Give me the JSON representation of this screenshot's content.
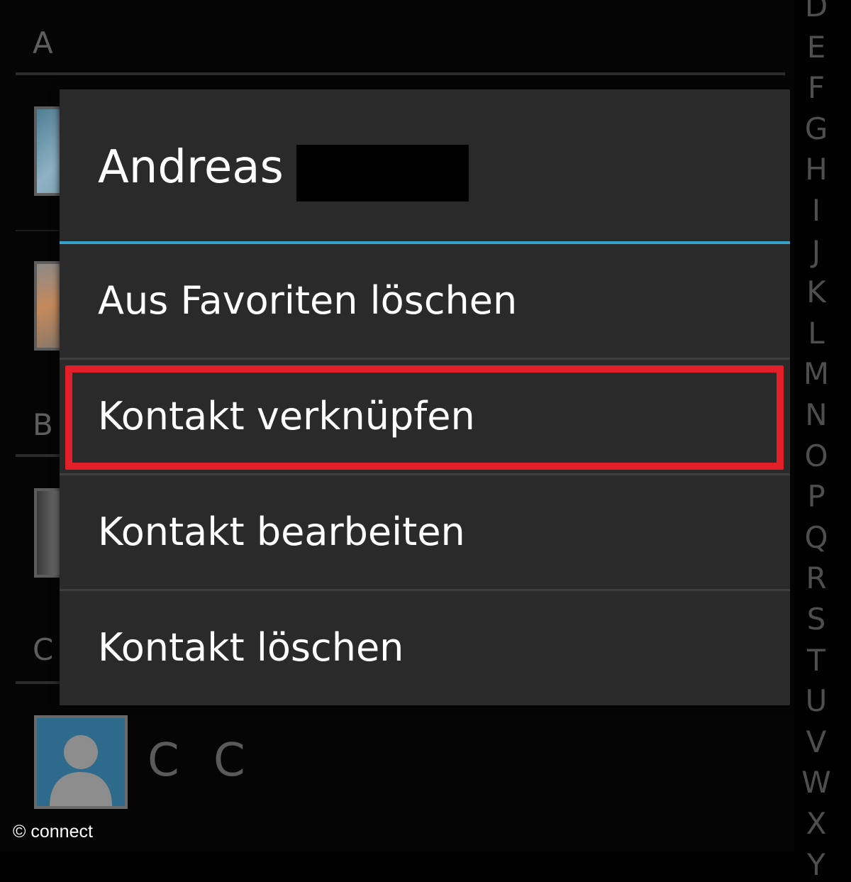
{
  "contacts_list": {
    "sections": [
      "A",
      "B",
      "C"
    ],
    "visible_contact_name": "C C"
  },
  "alphabet_index": [
    "D",
    "E",
    "F",
    "G",
    "H",
    "I",
    "J",
    "K",
    "L",
    "M",
    "N",
    "O",
    "P",
    "Q",
    "R",
    "S",
    "T",
    "U",
    "V",
    "W",
    "X",
    "Y"
  ],
  "context_menu": {
    "title": "Andreas",
    "items": [
      {
        "label": "Aus Favoriten löschen"
      },
      {
        "label": "Kontakt verknüpfen",
        "highlighted": true
      },
      {
        "label": "Kontakt bearbeiten"
      },
      {
        "label": "Kontakt löschen"
      }
    ]
  },
  "colors": {
    "accent_divider": "#33a3c7",
    "highlight": "#e3202a",
    "dialog_background": "#2a2a2a"
  },
  "watermark": "© connect"
}
